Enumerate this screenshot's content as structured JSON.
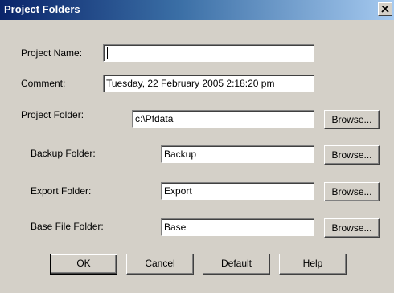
{
  "window": {
    "title": "Project Folders",
    "close_icon": "close-icon"
  },
  "form": {
    "project_name": {
      "label": "Project Name:",
      "value": ""
    },
    "comment": {
      "label": "Comment:",
      "value": "Tuesday, 22 February 2005 2:18:20 pm"
    },
    "project_folder": {
      "label": "Project Folder:",
      "value": "c:\\Pfdata",
      "browse_label": "Browse..."
    },
    "backup_folder": {
      "label": "Backup Folder:",
      "value": "Backup",
      "browse_label": "Browse..."
    },
    "export_folder": {
      "label": "Export Folder:",
      "value": "Export",
      "browse_label": "Browse..."
    },
    "base_file_folder": {
      "label": "Base File Folder:",
      "value": "Base",
      "browse_label": "Browse..."
    }
  },
  "buttons": {
    "ok": "OK",
    "cancel": "Cancel",
    "default": "Default",
    "help": "Help"
  },
  "colors": {
    "title_gradient_start": "#0a246a",
    "title_gradient_end": "#a6caf0",
    "dialog_face": "#d4d0c8"
  }
}
